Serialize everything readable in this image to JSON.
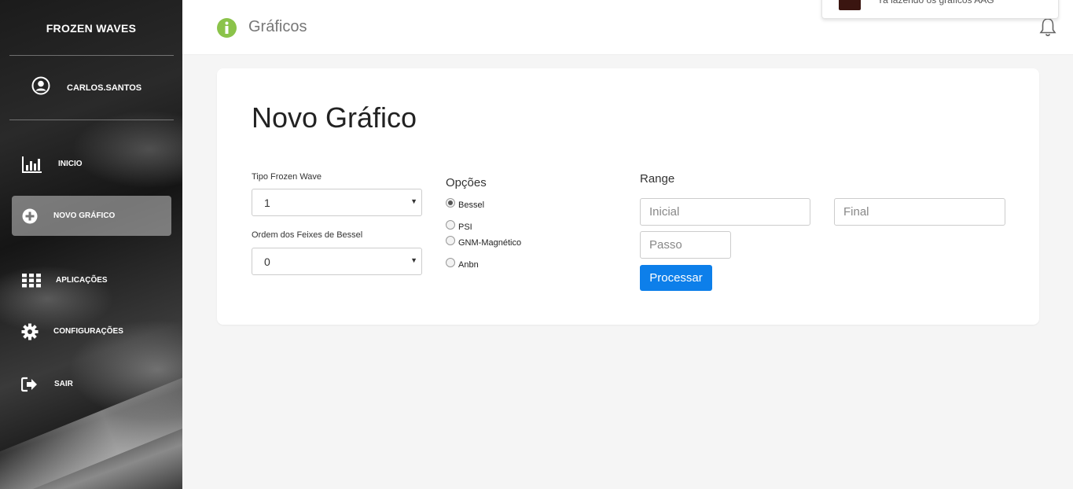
{
  "sidebar": {
    "brand": "FROZEN WAVES",
    "user": "CARLOS.SANTOS",
    "items": [
      {
        "label": "INICIO",
        "icon": "bar-chart-icon"
      },
      {
        "label": "NOVO GRÁFICO",
        "icon": "plus-circle-icon"
      },
      {
        "label": "APLICAÇÕES",
        "icon": "grid-icon"
      },
      {
        "label": "CONFIGURAÇÕES",
        "icon": "gear-icon"
      },
      {
        "label": "SAIR",
        "icon": "sign-out-icon"
      }
    ]
  },
  "header": {
    "title": "Gráficos",
    "notification_text": "Ya lazendo os graficos AAG"
  },
  "form": {
    "title": "Novo Gráfico",
    "tipo_label": "Tipo Frozen Wave",
    "tipo_value": "1",
    "ordem_label": "Ordem dos Feixes de Bessel",
    "ordem_value": "0",
    "options_title": "Opções",
    "options": [
      {
        "label": "Bessel",
        "checked": true
      },
      {
        "label": "PSI",
        "checked": false
      },
      {
        "label": "GNM-Magnético",
        "checked": false
      },
      {
        "label": "Anbn",
        "checked": false
      }
    ],
    "range_title": "Range",
    "inicial_placeholder": "Inicial",
    "final_placeholder": "Final",
    "passo_placeholder": "Passo",
    "submit_label": "Processar"
  },
  "colors": {
    "accent": "#0d7fea",
    "info_icon": "#8bc34a"
  }
}
